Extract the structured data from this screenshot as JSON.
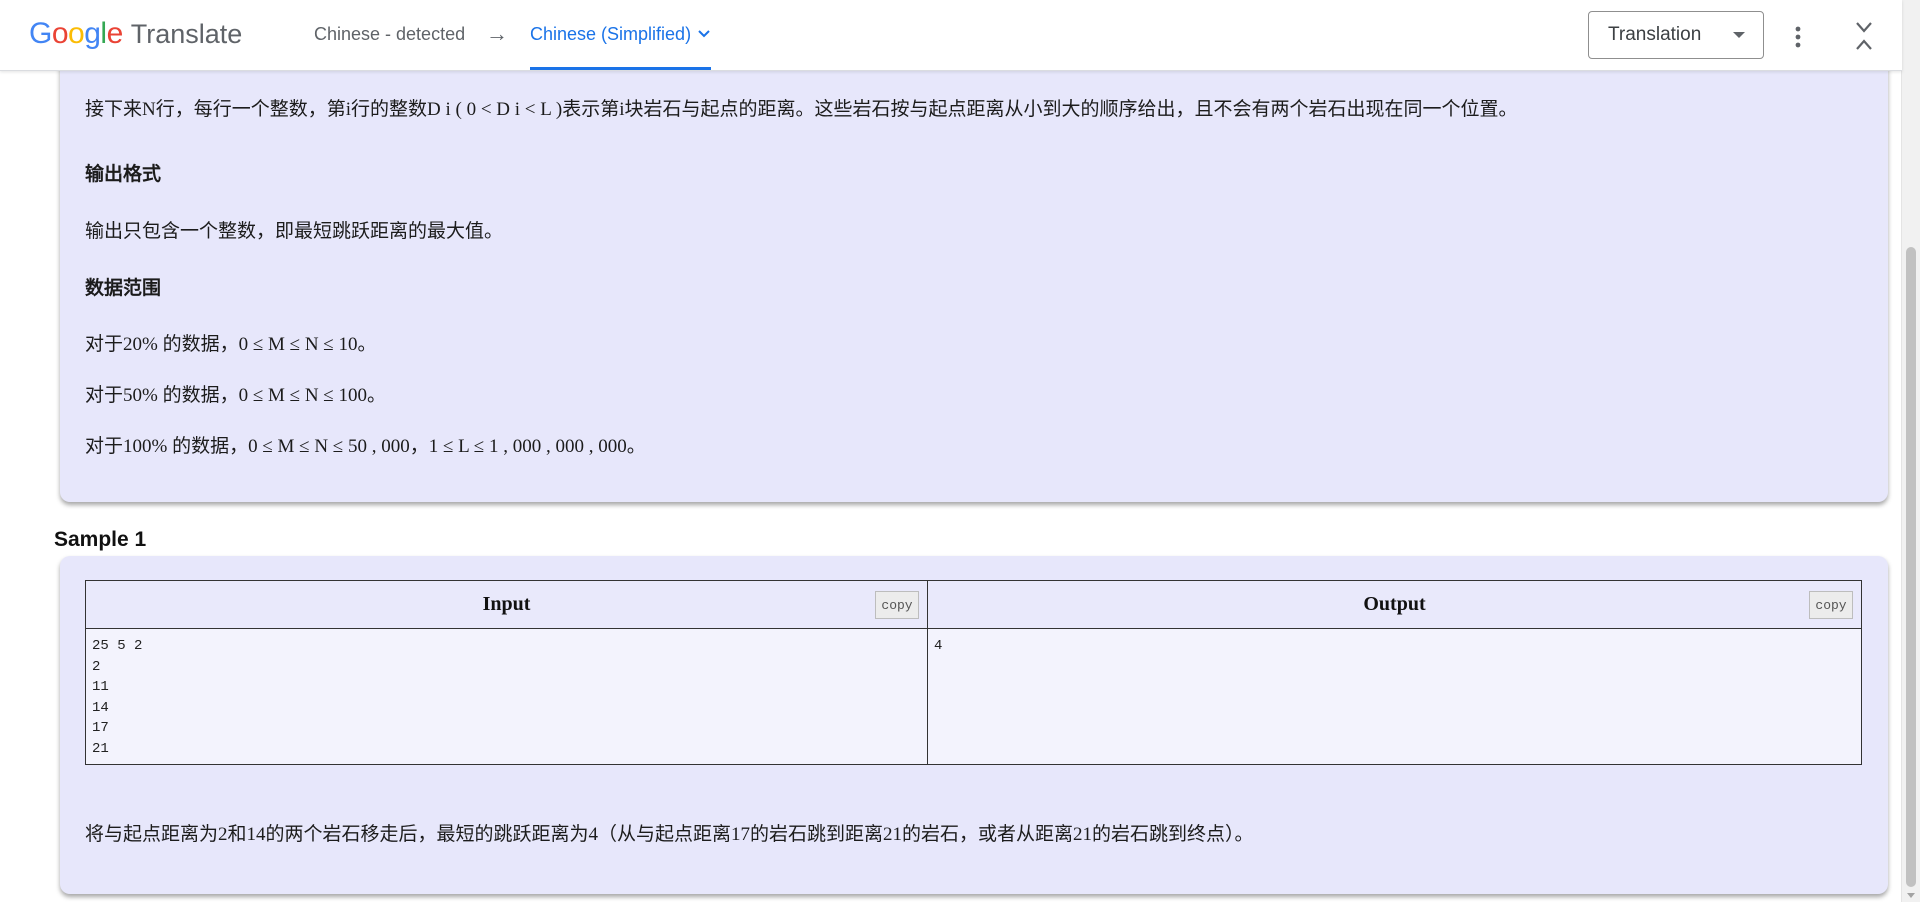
{
  "translate_bar": {
    "logo_google_letters": [
      "G",
      "o",
      "o",
      "g",
      "l",
      "e"
    ],
    "logo_colors": [
      "#4285F4",
      "#EA4335",
      "#FBBC05",
      "#4285F4",
      "#34A853",
      "#EA4335"
    ],
    "logo_word": "Translate",
    "source_language": "Chinese - detected",
    "arrow": "→",
    "target_language": "Chinese (Simplified)",
    "mode": "Translation",
    "accent_color": "#1a73e8"
  },
  "problem": {
    "input_desc": "接下来N行，每行一个整数，第i行的整数D i ( 0 < D i < L )表示第i块岩石与起点的距离。这些岩石按与起点距离从小到大的顺序给出，且不会有两个岩石出现在同一个位置。",
    "output_heading": "输出格式",
    "output_desc": "输出只包含一个整数，即最短跳跃距离的最大值。",
    "range_heading": "数据范围",
    "range_lines": [
      "对于20% 的数据，0 ≤ M ≤ N ≤ 10。",
      "对于50% 的数据，0 ≤ M ≤ N ≤ 100。",
      "对于100% 的数据，0 ≤ M ≤ N ≤ 50 , 000，1 ≤ L ≤ 1 , 000 , 000 , 000。"
    ]
  },
  "sample": {
    "title": "Sample 1",
    "input_label": "Input",
    "output_label": "Output",
    "copy_label": "copy",
    "input_lines": [
      "25 5 2",
      "2",
      "11",
      "14",
      "17",
      "21"
    ],
    "output_lines": [
      "4"
    ],
    "explanation": "将与起点距离为2和14的两个岩石移走后，最短的跳跃距离为4（从与起点距离17的岩石跳到距离21的岩石，或者从距离21的岩石跳到终点）。"
  },
  "card_color": "#e7e7fb"
}
